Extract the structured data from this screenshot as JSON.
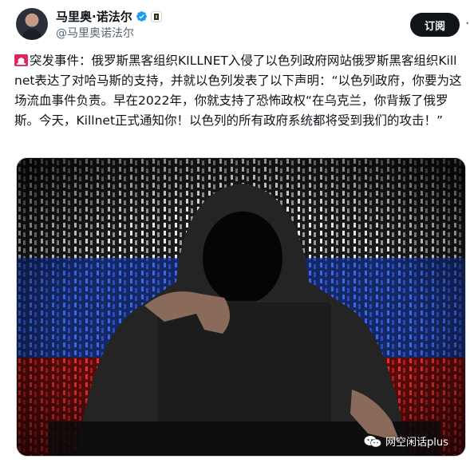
{
  "post": {
    "author_name": "马里奥·诺法尔",
    "author_handle": "@马里奥诺法尔",
    "subscribe_label": "订阅",
    "more_label": "···",
    "text": "突发事件：俄罗斯黑客组织KILLNET入侵了以色列政府网站俄罗斯黑客组织Killnet表达了对哈马斯的支持，并就以色列发表了以下声明：“以色列政府，你要为这场流血事件负责。早在2022年，你就支持了恐怖政权“在乌克兰，你背叛了俄罗斯。今天，Killnet正式通知你！以色列的所有政府系统都将受到我们的攻击！”"
  },
  "icons": {
    "verified": "verified-badge-icon",
    "affiliate": "affiliate-badge-icon",
    "alert": "rotating-light-icon",
    "more": "more-options-icon",
    "wechat": "wechat-logo-icon"
  },
  "watermark": {
    "text": "网空闲话plus"
  },
  "colors": {
    "verified_blue": "#1d9bf0",
    "button_dark": "#0f1419",
    "handle_gray": "#536471",
    "flag_white": "#e8e8e8",
    "flag_blue": "#1f3fb0",
    "flag_red": "#d21f1f"
  }
}
